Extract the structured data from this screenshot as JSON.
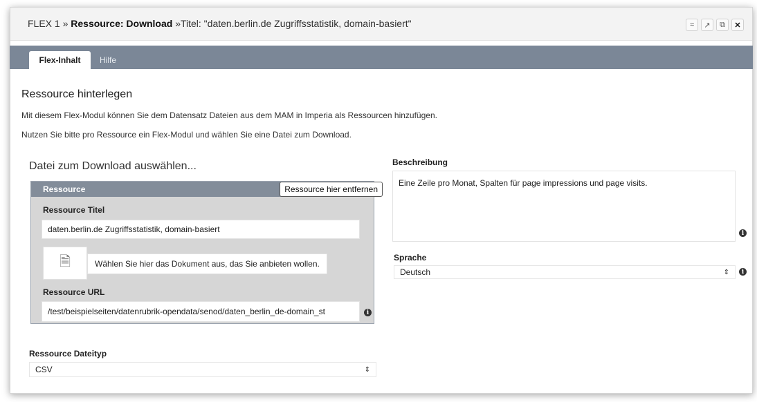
{
  "window": {
    "title_prefix": "FLEX 1 »",
    "title_bold": "Ressource: Download",
    "title_suffix": "»Titel: \"daten.berlin.de Zugriffsstatistik, domain-basiert\"",
    "controls": [
      {
        "name": "collapse-icon",
        "glyph": "≈"
      },
      {
        "name": "expand-icon",
        "glyph": "↗"
      },
      {
        "name": "copy-icon",
        "glyph": "⧉"
      },
      {
        "name": "close-icon",
        "glyph": "✕"
      }
    ]
  },
  "tabs": [
    {
      "label": "Flex-Inhalt"
    },
    {
      "label": "Hilfe"
    }
  ],
  "intro": {
    "heading": "Ressource hinterlegen",
    "line1": "Mit diesem Flex-Modul können Sie dem Datensatz Dateien aus dem MAM in Imperia als Ressourcen hinzufügen.",
    "line2": "Nutzen Sie bitte pro Ressource ein Flex-Modul und wählen Sie eine Datei zum Download."
  },
  "download": {
    "heading": "Datei zum Download auswählen...",
    "panel_label": "Ressource",
    "remove_button": "Ressource hier entfernen",
    "title_label": "Ressource Titel",
    "title_value": "daten.berlin.de Zugriffsstatistik, domain-basiert",
    "doc_hint": "Wählen Sie hier das Dokument aus, das Sie anbieten wollen.",
    "url_label": "Ressource URL",
    "url_value": "/test/beispielseiten/datenrubrik-opendata/senod/daten_berlin_de-domain_st",
    "filetype_label": "Ressource Dateityp",
    "filetype_value": "CSV"
  },
  "right": {
    "description_label": "Beschreibung",
    "description_value": "Eine Zeile pro Monat, Spalten für page impressions und page visits.",
    "language_label": "Sprache",
    "language_value": "Deutsch"
  },
  "info_glyph": "i",
  "select_glyph": "⇕",
  "doc_glyph": "🗎"
}
